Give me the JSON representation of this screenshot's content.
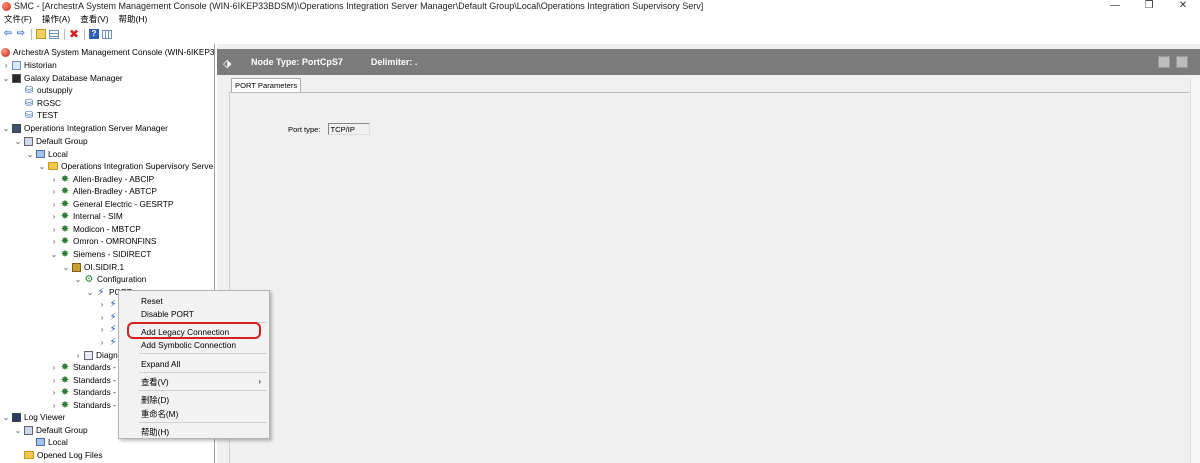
{
  "window": {
    "title": "SMC - [ArchestrA System Management Console (WIN-6IKEP33BDSM)\\Operations Integration Server Manager\\Default Group\\Local\\Operations Integration Supervisory Serv]",
    "minimize": "—",
    "restore": "❐",
    "close": "✕"
  },
  "menubar": {
    "file": "文件(F)",
    "action": "操作(A)",
    "view": "查看(V)",
    "help": "帮助(H)"
  },
  "toolbar": {
    "icons": [
      "back-icon",
      "forward-icon",
      "up-folder-icon",
      "list-view-icon",
      "delete-icon",
      "help-icon",
      "details-icon"
    ]
  },
  "tree": {
    "root": "ArchestrA System Management Console (WIN-6IKEP33",
    "historian": "Historian",
    "galaxy_db": "Galaxy Database Manager",
    "db_outsupply": "outsupply",
    "db_rgsc": "RGSC",
    "db_test": "TEST",
    "oism": "Operations Integration Server Manager",
    "default_group": "Default Group",
    "local": "Local",
    "ois_serv": "Operations Integration Supervisory Serve",
    "ab_abcip": "Allen-Bradley - ABCIP",
    "ab_abtcp": "Allen-Bradley - ABTCP",
    "ge_gesrtp": "General Electric - GESRTP",
    "internal_sim": "Internal - SIM",
    "modicon_mbtcp": "Modicon - MBTCP",
    "omron": "Omron - OMRONFINS",
    "siemens": "Siemens - SIDIRECT",
    "oi_sidir": "OI.SIDIR.1",
    "configuration": "Configuration",
    "port": "PORT",
    "diag": "Diagn",
    "std1": "Standards -",
    "std2": "Standards -",
    "std3": "Standards -",
    "std4": "Standards -",
    "log_viewer": "Log Viewer",
    "log_default_group": "Default Group",
    "log_local": "Local",
    "opened_logs": "Opened Log Files"
  },
  "header": {
    "node_type": "Node Type: PortCpS7",
    "delimiter": "Delimiter:  ."
  },
  "tab": {
    "label": "PORT Parameters"
  },
  "fields": {
    "port_type_label": "Port type:",
    "port_type_value": "TCP/IP"
  },
  "context_menu": {
    "reset": "Reset",
    "disable_port": "Disable PORT",
    "add_legacy": "Add Legacy Connection",
    "add_symbolic": "Add Symbolic Connection",
    "expand_all": "Expand All",
    "view": "查看(V)",
    "delete": "删除(D)",
    "rename": "重命名(M)",
    "help": "帮助(H)",
    "highlighted_item": "Add Legacy Connection",
    "highlight_color": "#d32020"
  }
}
